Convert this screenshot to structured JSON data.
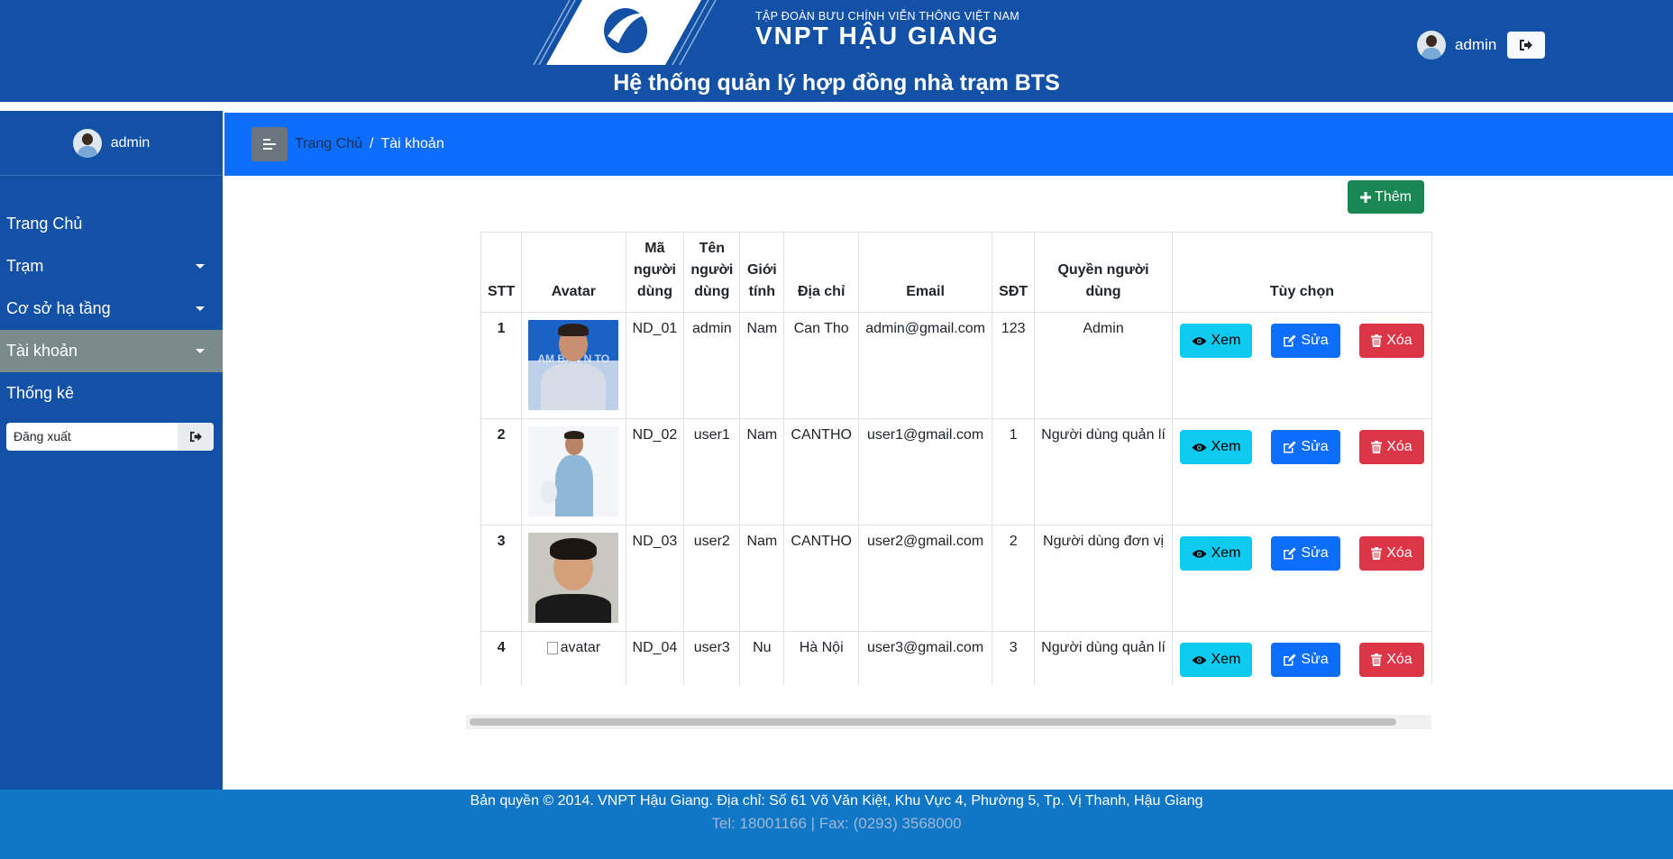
{
  "header": {
    "logo_line1": "TẬP ĐOÀN BƯU CHÍNH VIỄN THÔNG VIỆT NAM",
    "logo_line2": "VNPT HẬU GIANG",
    "system_title": "Hệ thống quản lý hợp đồng nhà trạm BTS",
    "username": "admin"
  },
  "sidebar": {
    "username": "admin",
    "items": [
      {
        "label": "Trang Chủ",
        "has_caret": false
      },
      {
        "label": "Trạm",
        "has_caret": true
      },
      {
        "label": "Cơ sở hạ tầng",
        "has_caret": true
      },
      {
        "label": "Tài khoản",
        "has_caret": true,
        "active": true
      },
      {
        "label": "Thống kê",
        "has_caret": false
      }
    ],
    "logout_label": "Đăng xuất"
  },
  "breadcrumb": {
    "home": "Trang Chủ",
    "separator": "/",
    "current": "Tài khoản"
  },
  "add_button_label": "Thêm",
  "table": {
    "headers": [
      "STT",
      "Avatar",
      "Mã người dùng",
      "Tên người dùng",
      "Giới tính",
      "Địa chỉ",
      "Email",
      "SĐT",
      "Quyền người dùng",
      "Tùy chọn"
    ],
    "rows": [
      {
        "stt": "1",
        "code": "ND_01",
        "name": "admin",
        "gender": "Nam",
        "address": "Can Tho",
        "email": "admin@gmail.com",
        "phone": "123",
        "role": "Admin"
      },
      {
        "stt": "2",
        "code": "ND_02",
        "name": "user1",
        "gender": "Nam",
        "address": "CANTHO",
        "email": "user1@gmail.com",
        "phone": "1",
        "role": "Người dùng quản lí"
      },
      {
        "stt": "3",
        "code": "ND_03",
        "name": "user2",
        "gender": "Nam",
        "address": "CANTHO",
        "email": "user2@gmail.com",
        "phone": "2",
        "role": "Người dùng đơn vị"
      },
      {
        "stt": "4",
        "code": "ND_04",
        "name": "user3",
        "gender": "Nu",
        "address": "Hà Nội",
        "email": "user3@gmail.com",
        "phone": "3",
        "role": "Người dùng quản lí",
        "avatar_alt": "avatar"
      }
    ],
    "actions": {
      "view": "Xem",
      "edit": "Sửa",
      "delete": "Xóa"
    },
    "photo_banner_text": "AM BAN   N TO"
  },
  "footer": {
    "copyright": "Bản quyền © 2014. VNPT Hậu Giang. Địa chỉ: Số 61 Võ Văn Kiệt, Khu Vực 4, Phường 5, Tp. Vị Thanh, Hậu Giang",
    "contact": "Tel: 18001166 | Fax: (0293) 3568000"
  },
  "colors": {
    "header_bg": "#1351a6",
    "topbar_bg": "#0d6efd",
    "footer_bg": "#1076c6",
    "btn_view": "#0dcaf0",
    "btn_edit": "#0d6efd",
    "btn_delete": "#dc3545",
    "btn_add": "#198754"
  },
  "icons": [
    "vnpt-logo",
    "logout-icon",
    "menu-toggle-icon",
    "plus-icon",
    "eye-icon",
    "edit-icon",
    "trash-icon",
    "caret-down-icon"
  ]
}
